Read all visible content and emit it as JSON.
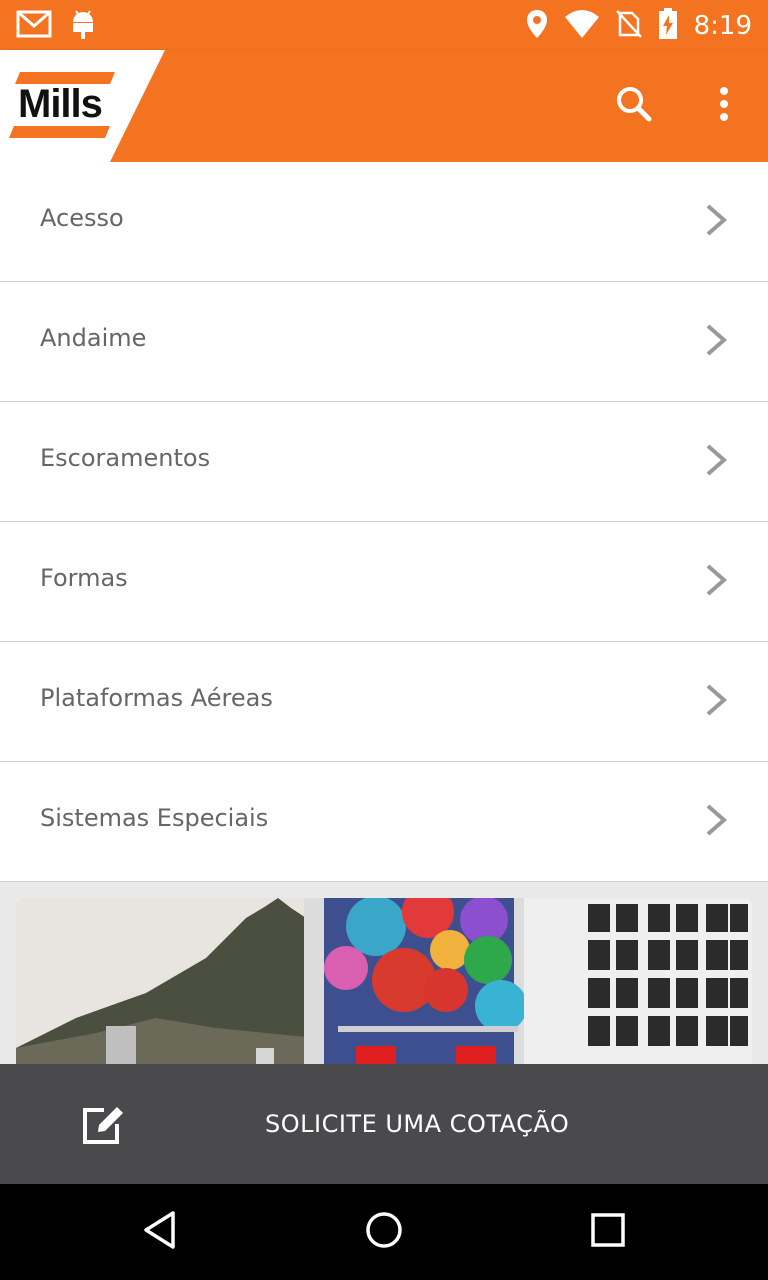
{
  "status_bar": {
    "time": "8:19",
    "left_icons": [
      "gmail-icon",
      "android-icon"
    ],
    "right_icons": [
      "location-icon",
      "wifi-icon",
      "no-sim-icon",
      "battery-charging-icon"
    ]
  },
  "app_bar": {
    "logo_text": "Mills",
    "actions": [
      "search-icon",
      "overflow-menu-icon"
    ],
    "color": "#f37321"
  },
  "categories": [
    {
      "label": "Acesso"
    },
    {
      "label": "Andaime"
    },
    {
      "label": "Escoramentos"
    },
    {
      "label": "Formas"
    },
    {
      "label": "Plataformas Aéreas"
    },
    {
      "label": "Sistemas Especiais"
    }
  ],
  "quote_bar": {
    "label": "SOLICITE UMA COTAÇÃO",
    "icon": "edit-icon"
  },
  "nav_bar": [
    "back-icon",
    "home-icon",
    "recents-icon"
  ]
}
